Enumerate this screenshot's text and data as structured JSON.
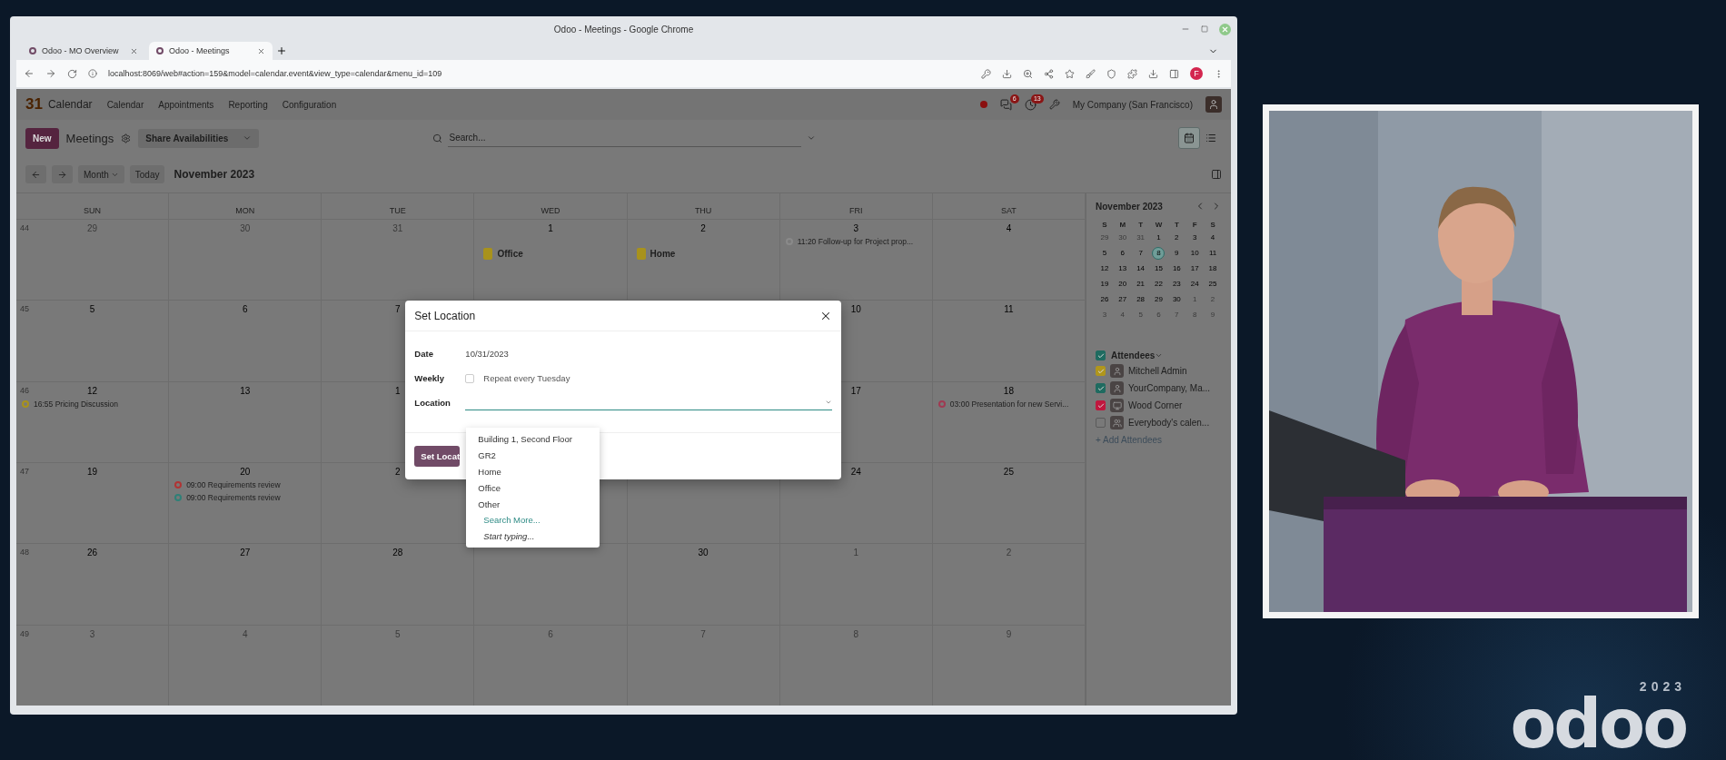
{
  "browser": {
    "title": "Odoo - Meetings - Google Chrome",
    "tabs": [
      {
        "label": "Odoo - MO Overview",
        "selected": false
      },
      {
        "label": "Odoo - Meetings",
        "selected": true
      }
    ],
    "url": "localhost:8069/web#action=159&model=calendar.event&view_type=calendar&menu_id=109",
    "profile": "F"
  },
  "app": {
    "app_icon": "31",
    "app_name": "Calendar",
    "menu": [
      "Calendar",
      "Appointments",
      "Reporting",
      "Configuration"
    ],
    "chat_count": "6",
    "activity_count": "13",
    "company": "My Company (San Francisco)",
    "new_button": "New",
    "breadcrumb": "Meetings",
    "share_button": "Share Availabilities",
    "search_placeholder": "Search...",
    "views": [
      {
        "kind": "calendar",
        "selected": true
      },
      {
        "kind": "list",
        "selected": false
      }
    ],
    "scale": "Month",
    "today": "Today",
    "period": "November 2023"
  },
  "calendar": {
    "weekdays": [
      "SUN",
      "MON",
      "TUE",
      "WED",
      "THU",
      "FRI",
      "SAT"
    ],
    "weeks": [
      {
        "number": "44",
        "days": [
          {
            "date": "29",
            "muted": true
          },
          {
            "date": "30",
            "muted": true
          },
          {
            "date": "31",
            "muted": true
          },
          {
            "date": "1",
            "muted": false,
            "events": [
              {
                "kind": "all_day",
                "text": "Office",
                "color": "#a8921c"
              }
            ]
          },
          {
            "date": "2",
            "muted": false,
            "events": [
              {
                "kind": "all_day",
                "text": "Home",
                "color": "#a8921c"
              }
            ]
          },
          {
            "date": "3",
            "muted": false,
            "events": [
              {
                "kind": "timed",
                "text": "11:20 Follow-up for Project prop...",
                "color": "#8a8a8a"
              }
            ]
          },
          {
            "date": "4",
            "muted": false
          }
        ]
      },
      {
        "number": "45",
        "days": [
          {
            "date": "5",
            "muted": false
          },
          {
            "date": "6",
            "muted": false
          },
          {
            "date": "7",
            "muted": false
          },
          {
            "date": "10",
            "muted": false
          },
          {
            "date": "11",
            "muted": false
          }
        ]
      },
      {
        "number": "46",
        "days": [
          {
            "date": "12",
            "muted": false,
            "events": [
              {
                "kind": "timed",
                "text": "16:55 Pricing Discussion",
                "color": "#a8921c"
              }
            ]
          },
          {
            "date": "13",
            "muted": false
          },
          {
            "date": "1",
            "muted": false
          },
          {
            "date": "17",
            "muted": false
          },
          {
            "date": "18",
            "muted": false,
            "events": [
              {
                "kind": "timed",
                "text": "03:00 Presentation for new Servi...",
                "color": "#a03a52"
              }
            ]
          }
        ]
      },
      {
        "number": "47",
        "days": [
          {
            "date": "19",
            "muted": false
          },
          {
            "date": "20",
            "muted": false,
            "events": [
              {
                "kind": "timed",
                "text": "09:00 Requirements review",
                "color": "#b03434"
              },
              {
                "kind": "timed",
                "text": "09:00 Requirements review",
                "color": "#2f8077"
              }
            ]
          },
          {
            "date": "2",
            "muted": false
          },
          {
            "covered": true
          },
          {
            "covered": true
          },
          {
            "date": "24",
            "muted": false
          },
          {
            "date": "25",
            "muted": false
          }
        ]
      },
      {
        "number": "48",
        "days": [
          {
            "date": "26",
            "muted": false
          },
          {
            "date": "27",
            "muted": false
          },
          {
            "date": "28",
            "muted": false
          },
          {
            "covered": true
          },
          {
            "date": "30",
            "muted": false
          },
          {
            "date": "1",
            "muted": true
          },
          {
            "date": "2",
            "muted": true
          }
        ]
      },
      {
        "number": "49",
        "days": [
          {
            "date": "3",
            "muted": true
          },
          {
            "date": "4",
            "muted": true
          },
          {
            "date": "5",
            "muted": true
          },
          {
            "date": "6",
            "muted": true
          },
          {
            "date": "7",
            "muted": true
          },
          {
            "date": "8",
            "muted": true
          },
          {
            "date": "9",
            "muted": true
          }
        ]
      }
    ]
  },
  "mini_calendar": {
    "title": "November 2023",
    "weekdays": [
      "S",
      "M",
      "T",
      "W",
      "T",
      "F",
      "S"
    ],
    "weeks": [
      [
        {
          "date": "29",
          "muted": true,
          "selected": false
        },
        {
          "date": "30",
          "muted": true,
          "selected": false
        },
        {
          "date": "31",
          "muted": true,
          "selected": false
        },
        {
          "date": "1",
          "muted": false,
          "selected": false
        },
        {
          "date": "2",
          "muted": false,
          "selected": false
        },
        {
          "date": "3",
          "muted": false,
          "selected": false
        },
        {
          "date": "4",
          "muted": false,
          "selected": false
        }
      ],
      [
        {
          "date": "5",
          "muted": false,
          "selected": false
        },
        {
          "date": "6",
          "muted": false,
          "selected": false
        },
        {
          "date": "7",
          "muted": false,
          "selected": false
        },
        {
          "date": "8",
          "muted": false,
          "selected": true
        },
        {
          "date": "9",
          "muted": false,
          "selected": false
        },
        {
          "date": "10",
          "muted": false,
          "selected": false
        },
        {
          "date": "11",
          "muted": false,
          "selected": false
        }
      ],
      [
        {
          "date": "12",
          "muted": false,
          "selected": false
        },
        {
          "date": "13",
          "muted": false,
          "selected": false
        },
        {
          "date": "14",
          "muted": false,
          "selected": false
        },
        {
          "date": "15",
          "muted": false,
          "selected": false
        },
        {
          "date": "16",
          "muted": false,
          "selected": false
        },
        {
          "date": "17",
          "muted": false,
          "selected": false
        },
        {
          "date": "18",
          "muted": false,
          "selected": false
        }
      ],
      [
        {
          "date": "19",
          "muted": false,
          "selected": false
        },
        {
          "date": "20",
          "muted": false,
          "selected": false
        },
        {
          "date": "21",
          "muted": false,
          "selected": false
        },
        {
          "date": "22",
          "muted": false,
          "selected": false
        },
        {
          "date": "23",
          "muted": false,
          "selected": false
        },
        {
          "date": "24",
          "muted": false,
          "selected": false
        },
        {
          "date": "25",
          "muted": false,
          "selected": false
        }
      ],
      [
        {
          "date": "26",
          "muted": false,
          "selected": false
        },
        {
          "date": "27",
          "muted": false,
          "selected": false
        },
        {
          "date": "28",
          "muted": false,
          "selected": false
        },
        {
          "date": "29",
          "muted": false,
          "selected": false
        },
        {
          "date": "30",
          "muted": false,
          "selected": false
        },
        {
          "date": "1",
          "muted": true,
          "selected": false
        },
        {
          "date": "2",
          "muted": true,
          "selected": false
        }
      ],
      [
        {
          "date": "3",
          "muted": true,
          "selected": false
        },
        {
          "date": "4",
          "muted": true,
          "selected": false
        },
        {
          "date": "5",
          "muted": true,
          "selected": false
        },
        {
          "date": "6",
          "muted": true,
          "selected": false
        },
        {
          "date": "7",
          "muted": true,
          "selected": false
        },
        {
          "date": "8",
          "muted": true,
          "selected": false
        },
        {
          "date": "9",
          "muted": true,
          "selected": false
        }
      ]
    ]
  },
  "attendees": {
    "title": "Attendees",
    "checked": true,
    "items": [
      {
        "name": "Mitchell Admin",
        "checked": true,
        "color": "#b0961c",
        "kind": "person"
      },
      {
        "name": "YourCompany, Ma...",
        "checked": true,
        "color": "#1f6b60",
        "kind": "person"
      },
      {
        "name": "Wood Corner",
        "checked": true,
        "color": "#c0173e",
        "kind": "screen"
      },
      {
        "name": "Everybody's calen...",
        "checked": false,
        "kind": "group"
      }
    ],
    "add_link": "+ Add Attendees"
  },
  "dialog": {
    "title": "Set Location",
    "fields": [
      {
        "kind": "text",
        "label": "Date",
        "value": "10/31/2023"
      },
      {
        "kind": "checkbox",
        "label": "Weekly",
        "checked": false,
        "text": "Repeat every Tuesday"
      },
      {
        "kind": "select",
        "label": "Location",
        "focused": true
      }
    ],
    "button": "Set Locat",
    "options": [
      {
        "kind": "option",
        "text": "Building 1, Second Floor"
      },
      {
        "kind": "option",
        "text": "GR2"
      },
      {
        "kind": "option",
        "text": "Home"
      },
      {
        "kind": "option",
        "text": "Office"
      },
      {
        "kind": "option",
        "text": "Other"
      },
      {
        "kind": "link",
        "text": "Search More..."
      },
      {
        "kind": "hint",
        "text": "Start typing..."
      }
    ]
  },
  "brand": {
    "year": "2023",
    "logo": "odoo"
  }
}
